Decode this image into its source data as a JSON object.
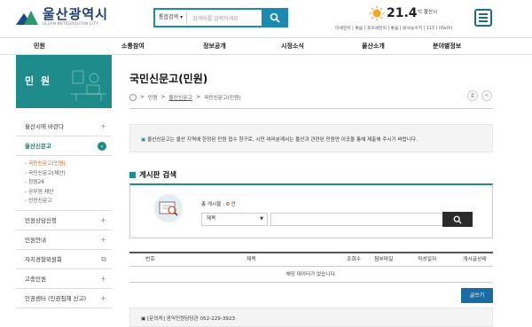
{
  "header": {
    "logo_text": "울산광역시",
    "logo_sub": "ULSAN METROPOLITAN CITY",
    "search_scope": "통합검색",
    "search_placeholder": "검색어를 입력하세요",
    "weather": {
      "temp": "21.4",
      "unit": "℃ 울산시",
      "air": "미세먼지 | 좋음 | 초미세먼지 | 좋음 | 방사능수치 | 113 ( nSv/h)"
    }
  },
  "gnb": [
    "민원",
    "소통참여",
    "정보공개",
    "시정소식",
    "울산소개",
    "분야별정보"
  ],
  "sidebar": {
    "title": "민 원",
    "items": [
      {
        "label": "울산시에 바란다"
      },
      {
        "label": "울산신문고"
      },
      {
        "label": "민원상담신청"
      },
      {
        "label": "민원안내"
      },
      {
        "label": "자치경찰위원회"
      },
      {
        "label": "고충민원"
      },
      {
        "label": "인권센터 (인권침해 신고)"
      }
    ],
    "subitems": [
      "국민신문고(민원)",
      "국민신문고(제안)",
      "정원24",
      "공무원 제안",
      "안전신문고"
    ]
  },
  "content": {
    "title": "국민신문고(민원)",
    "breadcrumb": [
      "민원",
      "울산신문고",
      "국민신문고(민원)"
    ],
    "notice": "울산신문고는 울산 지역에 한정된 민원 접수 창구로, 시민 여러분께서는 울산과 관련된 민원만 이곳을 통해 제출해 주시기 바랍니다.",
    "board_title": "게시판 검색",
    "count_label": "총 게시물 :",
    "count_value": "0",
    "count_unit": "건",
    "select_value": "제목",
    "table_headers": [
      "번호",
      "제목",
      "조회수",
      "첨부파일",
      "작성일자",
      "게시글상태"
    ],
    "empty_text": "해당 데이터가 없습니다.",
    "write_button": "글쓰기",
    "contact": "[문의처] 권익민원담당관 052-229-3923"
  },
  "colors": {
    "teal": "#1e8c8a",
    "blue": "#1a8ab3",
    "accent": "#d9541a"
  }
}
